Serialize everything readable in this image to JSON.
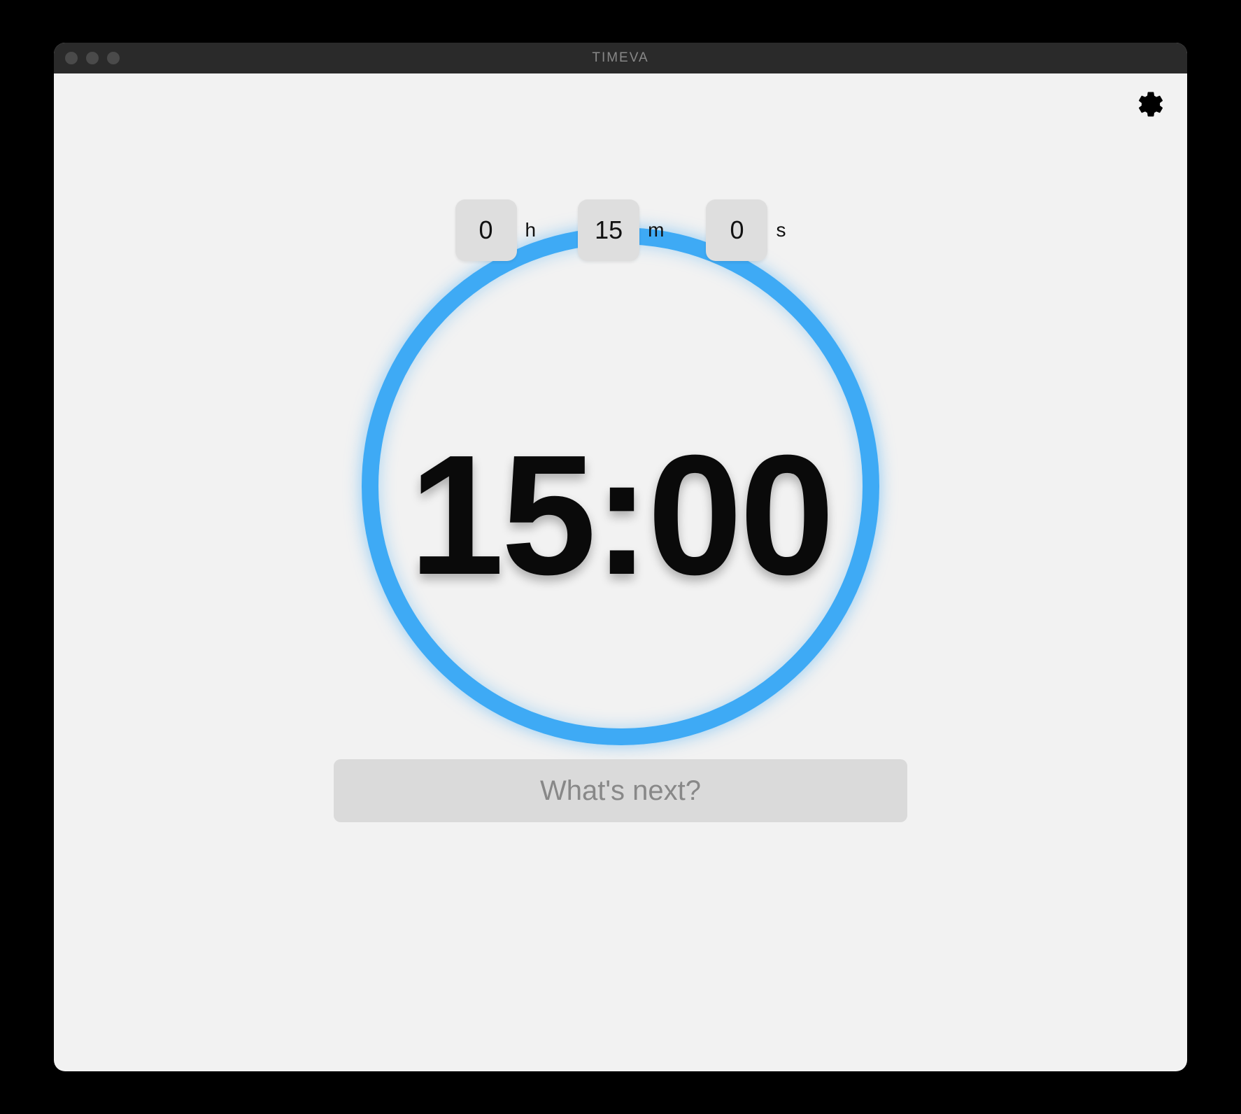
{
  "window": {
    "title": "TIMEVA"
  },
  "timer": {
    "hours": "0",
    "minutes": "15",
    "seconds": "0",
    "hours_unit": "h",
    "minutes_unit": "m",
    "seconds_unit": "s",
    "display": "15:00",
    "ring_color": "#3eaaf5"
  },
  "task": {
    "placeholder": "What's next?",
    "value": ""
  }
}
